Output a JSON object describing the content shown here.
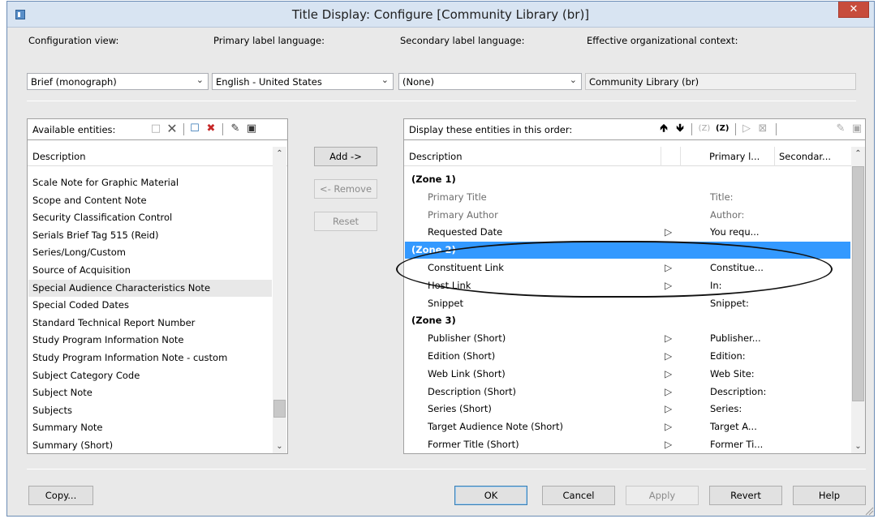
{
  "window": {
    "title": "Title Display: Configure [Community Library  (br)]",
    "close_glyph": "✕"
  },
  "header": {
    "config_view_label": "Configuration view:",
    "config_view_value": "Brief (monograph)",
    "primary_lang_label": "Primary label language:",
    "primary_lang_value": "English - United States",
    "secondary_lang_label": "Secondary label language:",
    "secondary_lang_value": "(None)",
    "org_context_label": "Effective organizational context:",
    "org_context_value": "Community Library  (br)"
  },
  "available": {
    "toolbar_label": "Available entities:",
    "column_header": "Description",
    "items": [
      "Scale Note for Graphic Material",
      "Scope and Content Note",
      "Security Classification Control",
      "Serials Brief Tag 515 (Reid)",
      "Series/Long/Custom",
      "Source of Acquisition",
      "Special Audience Characteristics Note",
      "Special Coded Dates",
      "Standard Technical Report Number",
      "Study Program Information Note",
      "Study Program Information Note - custom",
      "Subject Category Code",
      "Subject Note",
      "Subjects",
      "Summary Note",
      "Summary (Short)"
    ],
    "highlighted_index": 6
  },
  "middle_buttons": {
    "add": "Add ->",
    "remove": "<- Remove",
    "reset": "Reset"
  },
  "display": {
    "toolbar_label": "Display these entities in this order:",
    "columns": [
      "Description",
      "Primary l...",
      "Secondar..."
    ],
    "rows": [
      {
        "desc": "(Zone 1)",
        "type": "zone",
        "flag": false,
        "primary": ""
      },
      {
        "desc": "Primary Title",
        "type": "grey",
        "flag": false,
        "primary": "Title:"
      },
      {
        "desc": "Primary Author",
        "type": "grey",
        "flag": false,
        "primary": "Author:"
      },
      {
        "desc": "Requested Date",
        "type": "item",
        "flag": true,
        "primary": "You requ..."
      },
      {
        "desc": "(Zone 2)",
        "type": "selected",
        "flag": false,
        "primary": ""
      },
      {
        "desc": "Constituent Link",
        "type": "item",
        "flag": true,
        "primary": "Constitue..."
      },
      {
        "desc": "Host Link",
        "type": "item",
        "flag": true,
        "primary": "In:"
      },
      {
        "desc": "Snippet",
        "type": "item",
        "flag": false,
        "primary": "Snippet:"
      },
      {
        "desc": "(Zone 3)",
        "type": "zone",
        "flag": false,
        "primary": ""
      },
      {
        "desc": "Publisher (Short)",
        "type": "item",
        "flag": true,
        "primary": "Publisher..."
      },
      {
        "desc": "Edition (Short)",
        "type": "item",
        "flag": true,
        "primary": "Edition:"
      },
      {
        "desc": "Web Link (Short)",
        "type": "item",
        "flag": true,
        "primary": "Web Site:"
      },
      {
        "desc": "Description (Short)",
        "type": "item",
        "flag": true,
        "primary": "Description:"
      },
      {
        "desc": "Series (Short)",
        "type": "item",
        "flag": true,
        "primary": "Series:"
      },
      {
        "desc": "Target Audience Note (Short)",
        "type": "item",
        "flag": true,
        "primary": "Target A..."
      },
      {
        "desc": "Former Title (Short)",
        "type": "item",
        "flag": true,
        "primary": "Former Ti..."
      }
    ]
  },
  "footer": {
    "copy": "Copy...",
    "ok": "OK",
    "cancel": "Cancel",
    "apply": "Apply",
    "revert": "Revert",
    "help": "Help"
  },
  "colors": {
    "selection": "#3399ff",
    "title_bar": "#d8e4f2",
    "close_button": "#c74c3c"
  }
}
